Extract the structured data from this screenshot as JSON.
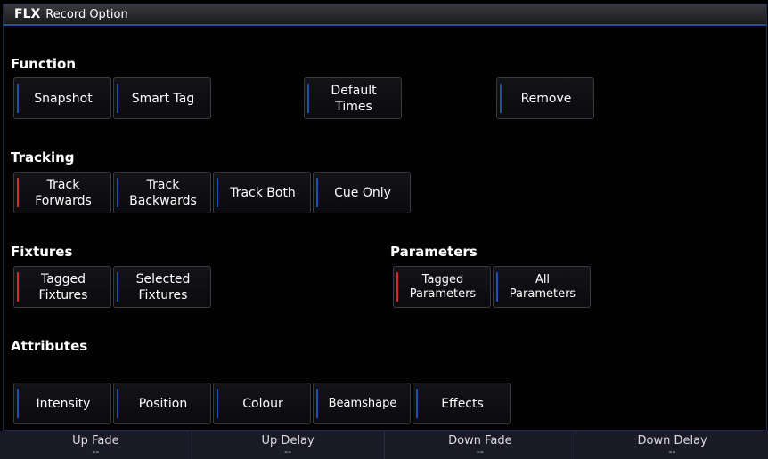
{
  "window": {
    "logo": "FLX",
    "title": "Record Option"
  },
  "sections": {
    "function": "Function",
    "tracking": "Tracking",
    "fixtures": "Fixtures",
    "parameters": "Parameters",
    "attributes": "Attributes"
  },
  "function_buttons": {
    "snapshot": "Snapshot",
    "smart_tag": "Smart Tag",
    "default_times": "Default\nTimes",
    "remove": "Remove"
  },
  "tracking_buttons": {
    "track_forwards": "Track\nForwards",
    "track_backwards": "Track\nBackwards",
    "track_both": "Track Both",
    "cue_only": "Cue Only"
  },
  "fixtures_buttons": {
    "tagged_fixtures": "Tagged\nFixtures",
    "selected_fixtures": "Selected\nFixtures"
  },
  "parameters_buttons": {
    "tagged_parameters": "Tagged\nParameters",
    "all_parameters": "All\nParameters"
  },
  "attributes_buttons": {
    "intensity": "Intensity",
    "position": "Position",
    "colour": "Colour",
    "beamshape": "Beamshape",
    "effects": "Effects"
  },
  "bottom_bar": [
    {
      "label": "Up Fade",
      "value": "--"
    },
    {
      "label": "Up Delay",
      "value": "--"
    },
    {
      "label": "Down Fade",
      "value": "--"
    },
    {
      "label": "Down Delay",
      "value": "--"
    }
  ],
  "colors": {
    "active_indicator": "#d42a2a",
    "inactive_indicator": "#1f4fb3",
    "title_underline": "#2b4e9a"
  }
}
